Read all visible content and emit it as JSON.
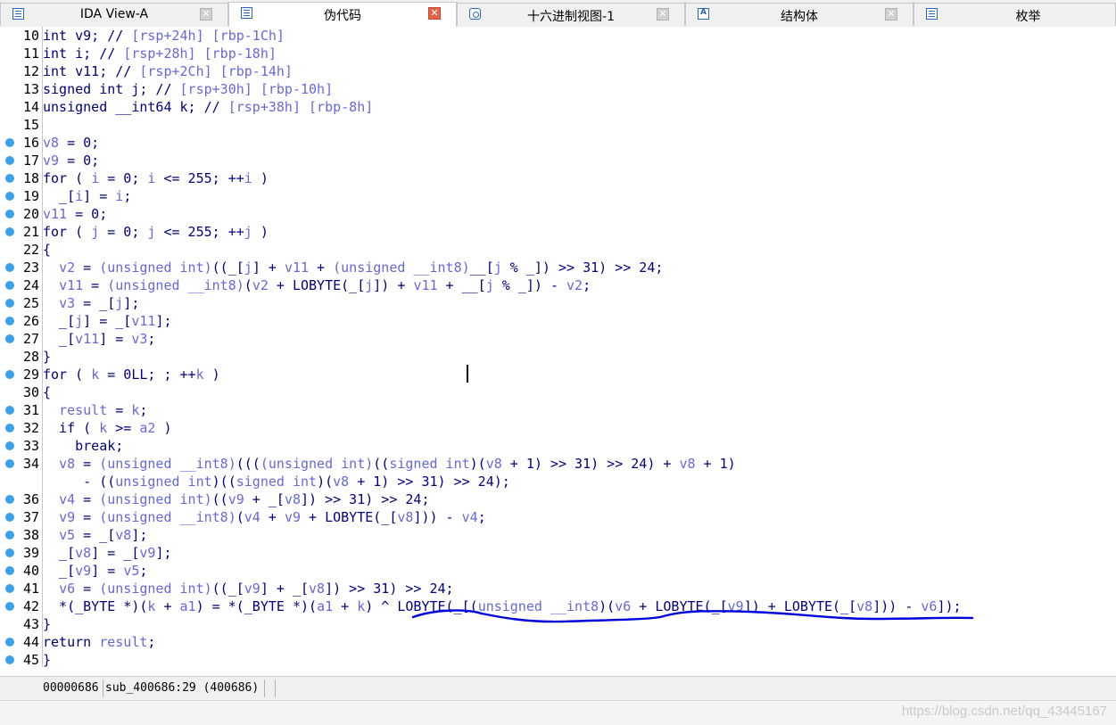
{
  "tabs": [
    {
      "label": "IDA View-A",
      "icon": "disassembly-icon",
      "active": false
    },
    {
      "label": "伪代码",
      "icon": "pseudocode-icon",
      "active": true
    },
    {
      "label": "十六进制视图-1",
      "icon": "hex-view-icon",
      "active": false
    },
    {
      "label": "结构体",
      "icon": "structures-icon",
      "active": false
    },
    {
      "label": "枚举",
      "icon": "enums-icon",
      "active": false
    }
  ],
  "colors": {
    "plain": "#000080",
    "variable": "#6767dd",
    "comment": "#6767dd",
    "breakpoint": "#3aa1e8",
    "underline": "#0000dd"
  },
  "code_lines": [
    {
      "num": "10",
      "bp": false,
      "segments": [
        [
          "p",
          "int v9; // "
        ],
        [
          "c",
          "[rsp+24h] [rbp-1Ch]"
        ]
      ]
    },
    {
      "num": "11",
      "bp": false,
      "segments": [
        [
          "p",
          "int i; // "
        ],
        [
          "c",
          "[rsp+28h] [rbp-18h]"
        ]
      ]
    },
    {
      "num": "12",
      "bp": false,
      "segments": [
        [
          "p",
          "int v11; // "
        ],
        [
          "c",
          "[rsp+2Ch] [rbp-14h]"
        ]
      ]
    },
    {
      "num": "13",
      "bp": false,
      "segments": [
        [
          "p",
          "signed int j; // "
        ],
        [
          "c",
          "[rsp+30h] [rbp-10h]"
        ]
      ]
    },
    {
      "num": "14",
      "bp": false,
      "segments": [
        [
          "p",
          "unsigned __int64 k; // "
        ],
        [
          "c",
          "[rsp+38h] [rbp-8h]"
        ]
      ]
    },
    {
      "num": "15",
      "bp": false,
      "segments": []
    },
    {
      "num": "16",
      "bp": true,
      "segments": [
        [
          "v",
          "v8"
        ],
        [
          "p",
          " = 0;"
        ]
      ]
    },
    {
      "num": "17",
      "bp": true,
      "segments": [
        [
          "v",
          "v9"
        ],
        [
          "p",
          " = 0;"
        ]
      ]
    },
    {
      "num": "18",
      "bp": true,
      "segments": [
        [
          "p",
          "for ( "
        ],
        [
          "v",
          "i"
        ],
        [
          "p",
          " = 0; "
        ],
        [
          "v",
          "i"
        ],
        [
          "p",
          " <= 255; ++"
        ],
        [
          "v",
          "i"
        ],
        [
          "p",
          " )"
        ]
      ]
    },
    {
      "num": "19",
      "bp": true,
      "segments": [
        [
          "p",
          "  _["
        ],
        [
          "v",
          "i"
        ],
        [
          "p",
          "] = "
        ],
        [
          "v",
          "i"
        ],
        [
          "p",
          ";"
        ]
      ]
    },
    {
      "num": "20",
      "bp": true,
      "segments": [
        [
          "v",
          "v11"
        ],
        [
          "p",
          " = 0;"
        ]
      ]
    },
    {
      "num": "21",
      "bp": true,
      "segments": [
        [
          "p",
          "for ( "
        ],
        [
          "v",
          "j"
        ],
        [
          "p",
          " = 0; "
        ],
        [
          "v",
          "j"
        ],
        [
          "p",
          " <= 255; ++"
        ],
        [
          "v",
          "j"
        ],
        [
          "p",
          " )"
        ]
      ]
    },
    {
      "num": "22",
      "bp": false,
      "segments": [
        [
          "p",
          "{"
        ]
      ]
    },
    {
      "num": "23",
      "bp": true,
      "segments": [
        [
          "p",
          "  "
        ],
        [
          "v",
          "v2"
        ],
        [
          "p",
          " = "
        ],
        [
          "v",
          "(unsigned int)"
        ],
        [
          "p",
          "((_["
        ],
        [
          "v",
          "j"
        ],
        [
          "p",
          "] + "
        ],
        [
          "v",
          "v11"
        ],
        [
          "p",
          " + "
        ],
        [
          "v",
          "(unsigned __int8)"
        ],
        [
          "p",
          "__["
        ],
        [
          "v",
          "j"
        ],
        [
          "p",
          " % _]) >> 31) >> 24;"
        ]
      ]
    },
    {
      "num": "24",
      "bp": true,
      "segments": [
        [
          "p",
          "  "
        ],
        [
          "v",
          "v11"
        ],
        [
          "p",
          " = "
        ],
        [
          "v",
          "(unsigned __int8)"
        ],
        [
          "p",
          "("
        ],
        [
          "v",
          "v2"
        ],
        [
          "p",
          " + LOBYTE(_["
        ],
        [
          "v",
          "j"
        ],
        [
          "p",
          "]) + "
        ],
        [
          "v",
          "v11"
        ],
        [
          "p",
          " + __["
        ],
        [
          "v",
          "j"
        ],
        [
          "p",
          " % _]) - "
        ],
        [
          "v",
          "v2"
        ],
        [
          "p",
          ";"
        ]
      ]
    },
    {
      "num": "25",
      "bp": true,
      "segments": [
        [
          "p",
          "  "
        ],
        [
          "v",
          "v3"
        ],
        [
          "p",
          " = _["
        ],
        [
          "v",
          "j"
        ],
        [
          "p",
          "];"
        ]
      ]
    },
    {
      "num": "26",
      "bp": true,
      "segments": [
        [
          "p",
          "  _["
        ],
        [
          "v",
          "j"
        ],
        [
          "p",
          "] = _["
        ],
        [
          "v",
          "v11"
        ],
        [
          "p",
          "];"
        ]
      ]
    },
    {
      "num": "27",
      "bp": true,
      "segments": [
        [
          "p",
          "  _["
        ],
        [
          "v",
          "v11"
        ],
        [
          "p",
          "] = "
        ],
        [
          "v",
          "v3"
        ],
        [
          "p",
          ";"
        ]
      ]
    },
    {
      "num": "28",
      "bp": false,
      "segments": [
        [
          "p",
          "}"
        ]
      ]
    },
    {
      "num": "29",
      "bp": true,
      "segments": [
        [
          "p",
          "for ( "
        ],
        [
          "v",
          "k"
        ],
        [
          "p",
          " = 0LL; ; ++"
        ],
        [
          "v",
          "k"
        ],
        [
          "p",
          " )"
        ]
      ]
    },
    {
      "num": "30",
      "bp": false,
      "segments": [
        [
          "p",
          "{"
        ]
      ]
    },
    {
      "num": "31",
      "bp": true,
      "segments": [
        [
          "p",
          "  "
        ],
        [
          "v",
          "result"
        ],
        [
          "p",
          " = "
        ],
        [
          "v",
          "k"
        ],
        [
          "p",
          ";"
        ]
      ]
    },
    {
      "num": "32",
      "bp": true,
      "segments": [
        [
          "p",
          "  if ( "
        ],
        [
          "v",
          "k"
        ],
        [
          "p",
          " >= "
        ],
        [
          "v",
          "a2"
        ],
        [
          "p",
          " )"
        ]
      ]
    },
    {
      "num": "33",
      "bp": true,
      "segments": [
        [
          "p",
          "    break;"
        ]
      ]
    },
    {
      "num": "34",
      "bp": true,
      "segments": [
        [
          "p",
          "  "
        ],
        [
          "v",
          "v8"
        ],
        [
          "p",
          " = "
        ],
        [
          "v",
          "(unsigned __int8)"
        ],
        [
          "p",
          "((("
        ],
        [
          "v",
          "(unsigned int)"
        ],
        [
          "p",
          "(("
        ],
        [
          "v",
          "signed int"
        ],
        [
          "p",
          ")("
        ],
        [
          "v",
          "v8"
        ],
        [
          "p",
          " + 1) >> 31) >> 24) + "
        ],
        [
          "v",
          "v8"
        ],
        [
          "p",
          " + 1)"
        ]
      ]
    },
    {
      "num": "",
      "bp": false,
      "segments": [
        [
          "p",
          "     - (("
        ],
        [
          "v",
          "unsigned int"
        ],
        [
          "p",
          ")(("
        ],
        [
          "v",
          "signed int"
        ],
        [
          "p",
          ")("
        ],
        [
          "v",
          "v8"
        ],
        [
          "p",
          " + 1) >> 31) >> 24);"
        ]
      ]
    },
    {
      "num": "36",
      "bp": true,
      "segments": [
        [
          "p",
          "  "
        ],
        [
          "v",
          "v4"
        ],
        [
          "p",
          " = "
        ],
        [
          "v",
          "(unsigned int)"
        ],
        [
          "p",
          "(("
        ],
        [
          "v",
          "v9"
        ],
        [
          "p",
          " + _["
        ],
        [
          "v",
          "v8"
        ],
        [
          "p",
          "]) >> 31) >> 24;"
        ]
      ]
    },
    {
      "num": "37",
      "bp": true,
      "segments": [
        [
          "p",
          "  "
        ],
        [
          "v",
          "v9"
        ],
        [
          "p",
          " = "
        ],
        [
          "v",
          "(unsigned __int8)"
        ],
        [
          "p",
          "("
        ],
        [
          "v",
          "v4"
        ],
        [
          "p",
          " + "
        ],
        [
          "v",
          "v9"
        ],
        [
          "p",
          " + LOBYTE(_["
        ],
        [
          "v",
          "v8"
        ],
        [
          "p",
          "])) - "
        ],
        [
          "v",
          "v4"
        ],
        [
          "p",
          ";"
        ]
      ]
    },
    {
      "num": "38",
      "bp": true,
      "segments": [
        [
          "p",
          "  "
        ],
        [
          "v",
          "v5"
        ],
        [
          "p",
          " = _["
        ],
        [
          "v",
          "v8"
        ],
        [
          "p",
          "];"
        ]
      ]
    },
    {
      "num": "39",
      "bp": true,
      "segments": [
        [
          "p",
          "  _["
        ],
        [
          "v",
          "v8"
        ],
        [
          "p",
          "] = _["
        ],
        [
          "v",
          "v9"
        ],
        [
          "p",
          "];"
        ]
      ]
    },
    {
      "num": "40",
      "bp": true,
      "segments": [
        [
          "p",
          "  _["
        ],
        [
          "v",
          "v9"
        ],
        [
          "p",
          "] = "
        ],
        [
          "v",
          "v5"
        ],
        [
          "p",
          ";"
        ]
      ]
    },
    {
      "num": "41",
      "bp": true,
      "segments": [
        [
          "p",
          "  "
        ],
        [
          "v",
          "v6"
        ],
        [
          "p",
          " = "
        ],
        [
          "v",
          "(unsigned int)"
        ],
        [
          "p",
          "((_["
        ],
        [
          "v",
          "v9"
        ],
        [
          "p",
          "] + _["
        ],
        [
          "v",
          "v8"
        ],
        [
          "p",
          "]) >> 31) >> 24;"
        ]
      ]
    },
    {
      "num": "42",
      "bp": true,
      "segments": [
        [
          "p",
          "  *(_BYTE *)("
        ],
        [
          "v",
          "k"
        ],
        [
          "p",
          " + "
        ],
        [
          "v",
          "a1"
        ],
        [
          "p",
          ") = *(_BYTE *)("
        ],
        [
          "v",
          "a1"
        ],
        [
          "p",
          " + "
        ],
        [
          "v",
          "k"
        ],
        [
          "p",
          ") ^ LOBYTE(_[("
        ],
        [
          "v",
          "unsigned __int8"
        ],
        [
          "p",
          ")("
        ],
        [
          "v",
          "v6"
        ],
        [
          "p",
          " + LOBYTE(_["
        ],
        [
          "v",
          "v9"
        ],
        [
          "p",
          "]) + LOBYTE(_["
        ],
        [
          "v",
          "v8"
        ],
        [
          "p",
          "])) - "
        ],
        [
          "v",
          "v6"
        ],
        [
          "p",
          "]);"
        ]
      ]
    },
    {
      "num": "43",
      "bp": false,
      "segments": [
        [
          "p",
          "}"
        ]
      ]
    },
    {
      "num": "44",
      "bp": true,
      "segments": [
        [
          "p",
          "return "
        ],
        [
          "v",
          "result"
        ],
        [
          "p",
          ";"
        ]
      ]
    },
    {
      "num": "45",
      "bp": true,
      "segments": [
        [
          "p",
          "}"
        ]
      ]
    }
  ],
  "status": {
    "address": "00000686",
    "location": "sub_400686:29 (400686)"
  },
  "watermark": "https://blog.csdn.net/qq_43445167"
}
